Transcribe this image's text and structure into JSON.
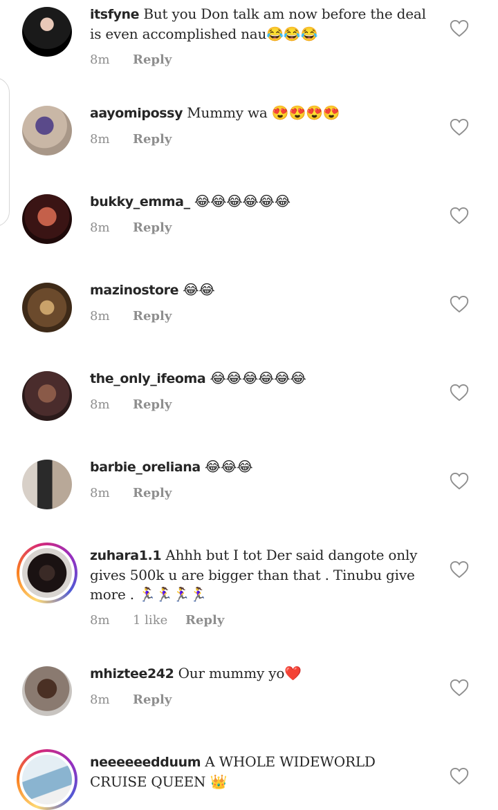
{
  "comments": [
    {
      "user": "itsfyne",
      "text": "But you Don talk am now before the deal is even accomplished nau😂😂😂",
      "time": "8m",
      "reply": "Reply"
    },
    {
      "user": "aayomipossy",
      "text": "Mummy wa 😍😍😍😍",
      "time": "8m",
      "reply": "Reply"
    },
    {
      "user": "bukky_emma_",
      "text": "😂😂😂😂😂😂",
      "time": "8m",
      "reply": "Reply"
    },
    {
      "user": "mazinostore",
      "text": "😂😂",
      "time": "8m",
      "reply": "Reply"
    },
    {
      "user": "the_only_ifeoma",
      "text": "😂😂😂😂😂😂",
      "time": "8m",
      "reply": "Reply"
    },
    {
      "user": "barbie_oreliana",
      "text": "😂😂😂",
      "time": "8m",
      "reply": "Reply"
    },
    {
      "user": "zuhara1.1",
      "text": "Ahhh but I tot Der said dangote only gives 500k u are bigger than that . Tinubu give more . 🏃‍♀️🏃‍♀️🏃‍♀️🏃‍♀️",
      "time": "8m",
      "likes": "1 like",
      "reply": "Reply"
    },
    {
      "user": "mhiztee242",
      "text": "Our mummy yo❤️",
      "time": "8m",
      "reply": "Reply"
    },
    {
      "user": "neeeeeedduum",
      "text": "A WHOLE WIDEWORLD CRUISE QUEEN 👑",
      "time": "",
      "reply": ""
    }
  ],
  "icons": {
    "like": "heart-outline-icon"
  },
  "colors": {
    "meta": "#8e8e8e",
    "heart": "#8e8e8e",
    "story_ring": "#d62976"
  }
}
